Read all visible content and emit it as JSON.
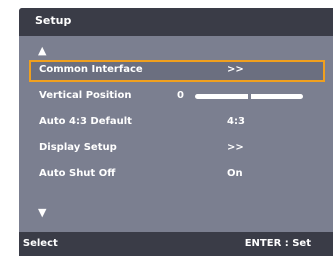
{
  "title": "Setup",
  "scroll": {
    "up_icon": "triangle-up-icon",
    "down_icon": "triangle-down-icon",
    "up_glyph": "▲",
    "down_glyph": "▼"
  },
  "menu": {
    "items": [
      {
        "label": "Common Interface",
        "value": ">>"
      },
      {
        "label": "Vertical Position",
        "value": "0",
        "slider_level": 0.5
      },
      {
        "label": "Auto 4:3 Default",
        "value": "4:3"
      },
      {
        "label": "Display Setup",
        "value": ">>"
      },
      {
        "label": "Auto Shut Off",
        "value": "On"
      }
    ],
    "selected_index": 0
  },
  "footer": {
    "nav_glyph": "▲▼",
    "select_label": ": Select",
    "enter_label": "ENTER : Set"
  },
  "colors": {
    "panel": "#7b7f90",
    "bar": "#3a3c47",
    "highlight_border": "#f0a01e",
    "text": "#ffffff"
  }
}
